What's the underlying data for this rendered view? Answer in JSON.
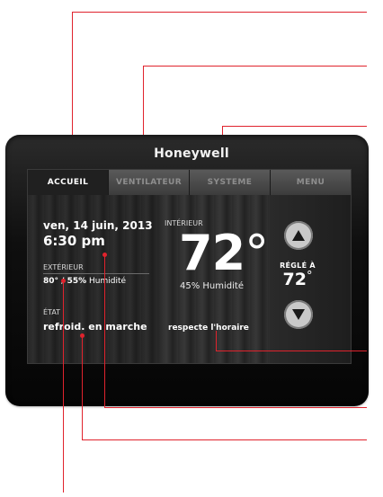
{
  "brand": "Honeywell",
  "tabs": [
    {
      "label": "ACCUEIL",
      "active": true
    },
    {
      "label": "VENTILATEUR",
      "active": false
    },
    {
      "label": "SYSTEME",
      "active": false
    },
    {
      "label": "MENU",
      "active": false
    }
  ],
  "status": {
    "date": "ven, 14 juin, 2013",
    "time": "6:30 pm",
    "outdoor_label": "EXTÉRIEUR",
    "outdoor_value": "80° / 55%",
    "outdoor_humidity_label": "Humidité",
    "state_label": "ÉTAT",
    "state_value": "refroid. en marche"
  },
  "indoor": {
    "label": "INTÉRIEUR",
    "temperature": "72",
    "degree": "°",
    "humidity": "45% Humidité",
    "schedule": "respecte l'horaire"
  },
  "setpoint": {
    "label": "RÉGLÉ À",
    "value": "72",
    "degree": "°"
  },
  "colors": {
    "callout": "#e0232d",
    "active_tab_bg": "#202020",
    "tab_bg": "#4a4a4a",
    "button": "#c9c9c9"
  },
  "icons": {
    "up": "arrow-up-icon",
    "down": "arrow-down-icon"
  }
}
